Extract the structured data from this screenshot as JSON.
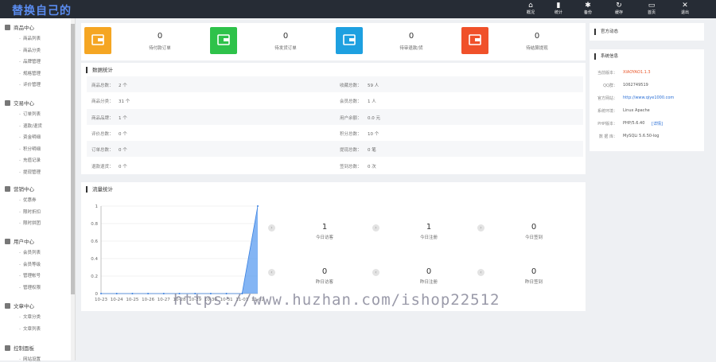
{
  "header": {
    "logo": "替换自己的",
    "buttons": [
      {
        "label": "概况",
        "icon": "home-icon",
        "glyph": "⌂"
      },
      {
        "label": "统计",
        "icon": "bar-chart-icon",
        "glyph": "▮"
      },
      {
        "label": "备份",
        "icon": "gear-icon",
        "glyph": "✱"
      },
      {
        "label": "缓存",
        "icon": "refresh-icon",
        "glyph": "↻"
      },
      {
        "label": "首页",
        "icon": "monitor-icon",
        "glyph": "▭"
      },
      {
        "label": "退出",
        "icon": "close-icon",
        "glyph": "✕"
      }
    ]
  },
  "sidebar": {
    "groups": [
      {
        "label": "商品中心",
        "items": [
          "商品列表",
          "商品分类",
          "品牌管理",
          "规格管理",
          "评价管理"
        ]
      },
      {
        "label": "交易中心",
        "items": [
          "订单列表",
          "退款/退货",
          "资金明细",
          "积分明细",
          "充值记录",
          "提现管理"
        ]
      },
      {
        "label": "营销中心",
        "items": [
          "优惠券",
          "限时折扣",
          "限时拼团"
        ]
      },
      {
        "label": "用户中心",
        "items": [
          "会员列表",
          "会员等级",
          "管理帐号",
          "管理权限"
        ]
      },
      {
        "label": "文章中心",
        "items": [
          "文章分类",
          "文章列表"
        ]
      },
      {
        "label": "控制面板",
        "items": [
          "网站设置"
        ]
      }
    ]
  },
  "stats": [
    {
      "value": "0",
      "label": "待付款订单",
      "color": "#f5a623"
    },
    {
      "value": "0",
      "label": "待发货订单",
      "color": "#2ec24a"
    },
    {
      "value": "0",
      "label": "待审退款/货",
      "color": "#1ea0e0"
    },
    {
      "value": "0",
      "label": "待结算提现",
      "color": "#f0512a"
    }
  ],
  "data_panel": {
    "title": "数据统计",
    "rows": [
      {
        "k1": "商品总数：",
        "v1": "2 个",
        "k2": "收藏总数：",
        "v2": "59 人"
      },
      {
        "k1": "商品分类：",
        "v1": "31 个",
        "k2": "会员总数：",
        "v2": "1 人"
      },
      {
        "k1": "商品品牌：",
        "v1": "1 个",
        "k2": "用户余额：",
        "v2": "0.0 元"
      },
      {
        "k1": "评价总数：",
        "v1": "0 个",
        "k2": "积分总数：",
        "v2": "10 个"
      },
      {
        "k1": "订单总数：",
        "v1": "0 个",
        "k2": "提现总数：",
        "v2": "0 笔"
      },
      {
        "k1": "退款退货：",
        "v1": "0 个",
        "k2": "签到总数：",
        "v2": "0 次"
      }
    ]
  },
  "traffic_panel": {
    "title": "流量统计",
    "tiles": [
      {
        "value": "1",
        "label": "今日访客"
      },
      {
        "value": "1",
        "label": "今日注册"
      },
      {
        "value": "0",
        "label": "今日签到"
      },
      {
        "value": "0",
        "label": "昨日访客"
      },
      {
        "value": "0",
        "label": "昨日注册"
      },
      {
        "value": "0",
        "label": "昨日签到"
      }
    ]
  },
  "chart_data": {
    "type": "area",
    "categories": [
      "10-23",
      "10-24",
      "10-25",
      "10-26",
      "10-27",
      "10-28",
      "10-29",
      "10-30",
      "10-31",
      "11-01",
      "11-02"
    ],
    "values": [
      0,
      0,
      0,
      0,
      0,
      0,
      0,
      0,
      0,
      0,
      1
    ],
    "ylim": [
      0,
      1
    ],
    "yticks": [
      "0",
      "0.2",
      "0.4",
      "0.6",
      "0.8",
      "1"
    ],
    "grid": true,
    "color": "#5b9cf0"
  },
  "official": {
    "title": "官方动态"
  },
  "sysinfo": {
    "title": "系统信息",
    "rows": [
      {
        "k": "当前版本：",
        "v": "XIAOYAO1.1.3",
        "color": "#e8562a",
        "link": ""
      },
      {
        "k": "QQ群：",
        "v": "1062749519",
        "color": "#555",
        "link": ""
      },
      {
        "k": "官方网站：",
        "v": "http://www.qiye1000.com",
        "color": "#2a6fd6",
        "link": ""
      },
      {
        "k": "系统环境：",
        "v": "Linux Apache",
        "color": "#555",
        "link": ""
      },
      {
        "k": "PHP版本：",
        "v": "PHP/5.6.40",
        "color": "#555",
        "link": "[详情]"
      },
      {
        "k": "数 据 库：",
        "v": "MySQLi 5.6.50-log",
        "color": "#555",
        "link": ""
      }
    ]
  },
  "watermark": "https://www.huzhan.com/ishop22512"
}
